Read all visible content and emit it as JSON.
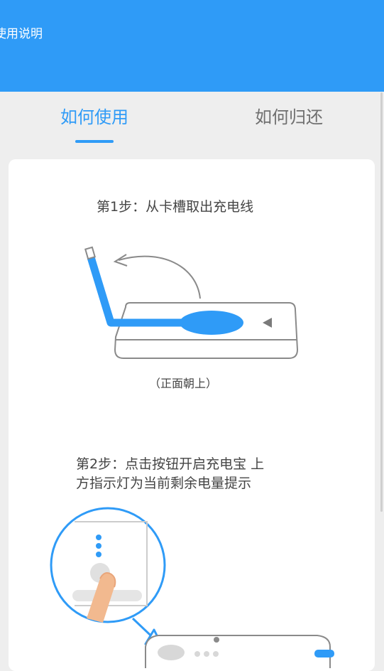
{
  "header": {
    "title": "使用说明"
  },
  "tabs": [
    {
      "label": "如何使用",
      "active": true
    },
    {
      "label": "如何归还",
      "active": false
    }
  ],
  "steps": [
    {
      "title": "第1步：从卡槽取出充电线",
      "caption": "（正面朝上）"
    },
    {
      "title_line1": "第2步：点击按钮开启充电宝 上",
      "title_line2": "方指示灯为当前剩余电量提示"
    }
  ],
  "colors": {
    "accent": "#2f9bf7",
    "inactive_tab": "#6f6f6f",
    "background": "#eeeeee",
    "card": "#ffffff",
    "skin": "#f2b98f"
  }
}
